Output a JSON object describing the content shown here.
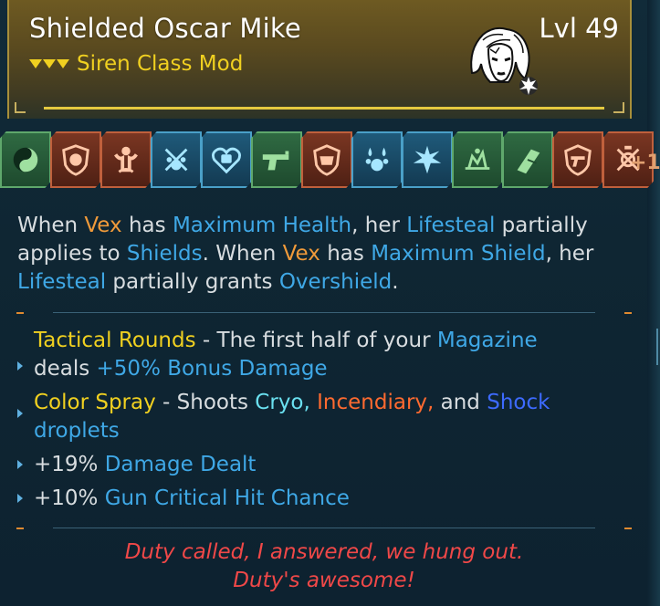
{
  "item": {
    "name": "Shielded Oscar Mike",
    "level": "Lvl 49",
    "type": "Siren Class Mod",
    "rarity_color": "#f0d020"
  },
  "skills": [
    {
      "icon": "yin-yang-skill-icon",
      "color": "green"
    },
    {
      "icon": "shield-face-skill-icon",
      "color": "red"
    },
    {
      "icon": "muscle-figure-skill-icon",
      "color": "red"
    },
    {
      "icon": "cross-paw-skill-icon",
      "color": "blue"
    },
    {
      "icon": "fist-heart-skill-icon",
      "color": "blue"
    },
    {
      "icon": "pistol-skill-icon",
      "color": "green"
    },
    {
      "icon": "shield-mask-skill-icon",
      "color": "red"
    },
    {
      "icon": "droplets-paw-skill-icon",
      "color": "blue"
    },
    {
      "icon": "spiky-paw-skill-icon",
      "color": "blue"
    },
    {
      "icon": "burst-skill-icon",
      "color": "green"
    },
    {
      "icon": "crystal-skill-icon",
      "color": "green"
    },
    {
      "icon": "gun-shield-skill-icon",
      "color": "red"
    },
    {
      "icon": "target-cross-skill-icon",
      "color": "red"
    }
  ],
  "more_skills": "+1",
  "description": {
    "p1": "When ",
    "vex1": "Vex",
    "p2": " has ",
    "max_health": "Maximum Health",
    "p3": ", her ",
    "lifesteal1": "Lifesteal",
    "p4": " partially applies to ",
    "shields": "Shields",
    "p5": ". When ",
    "vex2": "Vex",
    "p6": " has ",
    "max_shield": "Maximum Shield",
    "p7": ", her ",
    "lifesteal2": "Lifesteal",
    "p8": " partially grants ",
    "overshield": "Overshield",
    "p9": "."
  },
  "perks": {
    "tactical": {
      "name": "Tactical Rounds",
      "t1": " - The first half of your ",
      "magazine": "Magazine",
      "t2": " deals ",
      "bonus": "+50% Bonus Damage"
    },
    "spray": {
      "name": "Color Spray",
      "t1": " - Shoots ",
      "cryo": "Cryo,",
      "t2": " ",
      "incendiary": "Incendiary,",
      "t3": " and ",
      "shock": "Shock",
      "t4": " ",
      "droplets": "droplets"
    },
    "damage": {
      "value": "+19% ",
      "label": "Damage Dealt"
    },
    "crit": {
      "value": "+10% ",
      "label": "Gun Critical Hit Chance"
    }
  },
  "flavor": {
    "line1": "Duty called, I answered, we hung out.",
    "line2": "Duty's awesome!"
  }
}
